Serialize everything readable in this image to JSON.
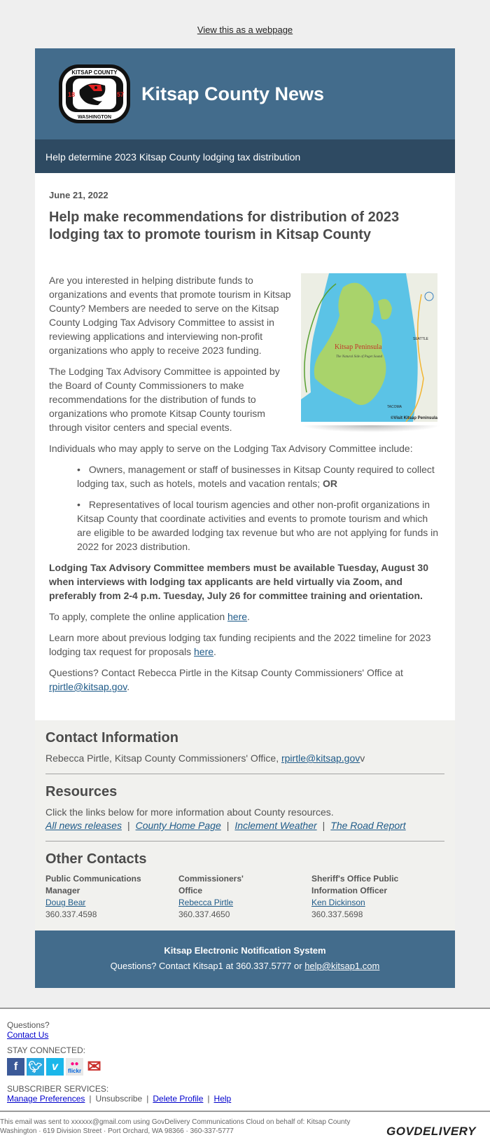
{
  "top_link": "View this as a webpage",
  "masthead": {
    "title": "Kitsap County News",
    "logo": {
      "top_text": "KITSAP COUNTY",
      "bottom_text": "WASHINGTON",
      "left_year": "18",
      "right_year": "57"
    }
  },
  "subbar": "Help determine 2023 Kitsap County lodging tax distribution",
  "article": {
    "date": "June 21, 2022",
    "headline": "Help make recommendations for distribution of 2023 lodging tax to promote tourism in Kitsap County",
    "map": {
      "label_main": "Kitsap Peninsula",
      "label_sub": "The Natural Side of Puget Sound",
      "credit": "©Visit Kitsap Peninsula",
      "city": "SEATTLE",
      "city2": "TACOMA"
    },
    "p1": "Are you interested in helping distribute funds to organizations and events that promote tourism in Kitsap County? Members are needed to serve on the Kitsap County Lodging Tax Advisory Committee to assist in reviewing applications and interviewing non-profit organizations who apply to receive 2023 funding.",
    "p2": "The Lodging Tax Advisory Committee is appointed by the Board of County Commissioners to make recommendations for the distribution of funds to organizations who promote Kitsap County tourism through visitor centers and special events.",
    "p3": "Individuals who may apply to serve on the Lodging Tax Advisory Committee include:",
    "bullets": [
      {
        "text": "Owners, management or staff of businesses in Kitsap County required to collect lodging tax, such as hotels, motels and vacation rentals; ",
        "bold": "OR"
      },
      {
        "text": "Representatives of local tourism agencies and other non-profit organizations in Kitsap County that coordinate activities and events to promote tourism and which are eligible to be awarded lodging tax revenue but who are not applying for funds in 2022 for 2023 distribution.",
        "bold": ""
      }
    ],
    "bold_para": "Lodging Tax Advisory Committee members must be available Tuesday, August 30 when interviews with lodging tax applicants are held virtually via Zoom, and preferably from 2-4 p.m. Tuesday, July 26 for committee training and orientation.",
    "apply_text": "To apply, complete the online application ",
    "apply_link": "here",
    "learn_text": "Learn more about previous lodging tax funding recipients and the 2022 timeline for 2023 lodging tax request for proposals ",
    "learn_link": "here",
    "questions_text": "Questions? Contact Rebecca Pirtle in the Kitsap County Commissioners' Office at ",
    "questions_link": "rpirtle@kitsap.gov"
  },
  "contact_info": {
    "heading": "Contact Information",
    "text": "Rebecca Pirtle, Kitsap County Commissioners' Office, ",
    "email": "rpirtle@kitsap.gov",
    "trailing": "v"
  },
  "resources": {
    "heading": "Resources",
    "text": "Click the links below for more information about County resources.",
    "links": [
      "All news releases",
      "County Home Page",
      "Inclement Weather",
      "The Road Report"
    ]
  },
  "other_contacts": {
    "heading": "Other Contacts",
    "people": [
      {
        "title": "Public Communications Manager",
        "name": "Doug Bear",
        "phone": "360.337.4598"
      },
      {
        "title": "Commissioners' Office",
        "name": "Rebecca Pirtle",
        "phone": "360.337.4650"
      },
      {
        "title": "Sheriff's Office Public Information Officer",
        "name": "Ken Dickinson",
        "phone": "360.337.5698"
      }
    ]
  },
  "footer_banner": {
    "title": "Kitsap Electronic Notification System",
    "text": "Questions? Contact Kitsap1 at 360.337.5777 or ",
    "email": "help@kitsap1.com"
  },
  "gov_footer": {
    "questions": "Questions?",
    "contact_us": "Contact Us",
    "stay_connected": "STAY CONNECTED:",
    "social": [
      {
        "name": "facebook",
        "glyph": "f",
        "color": "#3b5998"
      },
      {
        "name": "twitter",
        "glyph": "t",
        "color": "#2aa9e0"
      },
      {
        "name": "vimeo",
        "glyph": "v",
        "color": "#1ab7ea"
      },
      {
        "name": "flickr",
        "glyph": "flickr",
        "color": "#e8e8e8"
      },
      {
        "name": "email",
        "glyph": "✉",
        "color": "#c9302c"
      }
    ],
    "subscriber_services": "SUBSCRIBER SERVICES:",
    "sub_links": [
      "Manage Preferences",
      "Unsubscribe",
      "Delete Profile",
      "Help"
    ],
    "legal": "This email was sent to xxxxxx@gmail.com using GovDelivery Communications Cloud on behalf of: Kitsap County Washington · 619 Division Street · Port Orchard, WA 98366 · 360-337-5777",
    "brand": "GOVDELIVERY"
  }
}
